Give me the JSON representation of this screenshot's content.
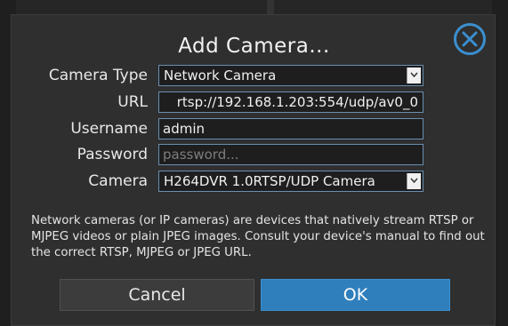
{
  "dialog": {
    "title": "Add Camera...",
    "close_icon": "close-circle-icon",
    "accent_color": "#3a8fd0"
  },
  "form": {
    "camera_type": {
      "label": "Camera Type",
      "value": "Network Camera"
    },
    "url": {
      "label": "URL",
      "value": "rtsp://192.168.1.203:554/udp/av0_0"
    },
    "username": {
      "label": "Username",
      "value": "admin"
    },
    "password": {
      "label": "Password",
      "value": "",
      "placeholder": "password..."
    },
    "camera": {
      "label": "Camera",
      "value": "H264DVR 1.0RTSP/UDP Camera"
    }
  },
  "info_text": "Network cameras (or IP cameras) are devices that natively stream RTSP or MJPEG videos or plain JPEG images. Consult your device's manual to find out the correct RTSP, MJPEG or JPEG URL.",
  "buttons": {
    "cancel": "Cancel",
    "ok": "OK"
  }
}
